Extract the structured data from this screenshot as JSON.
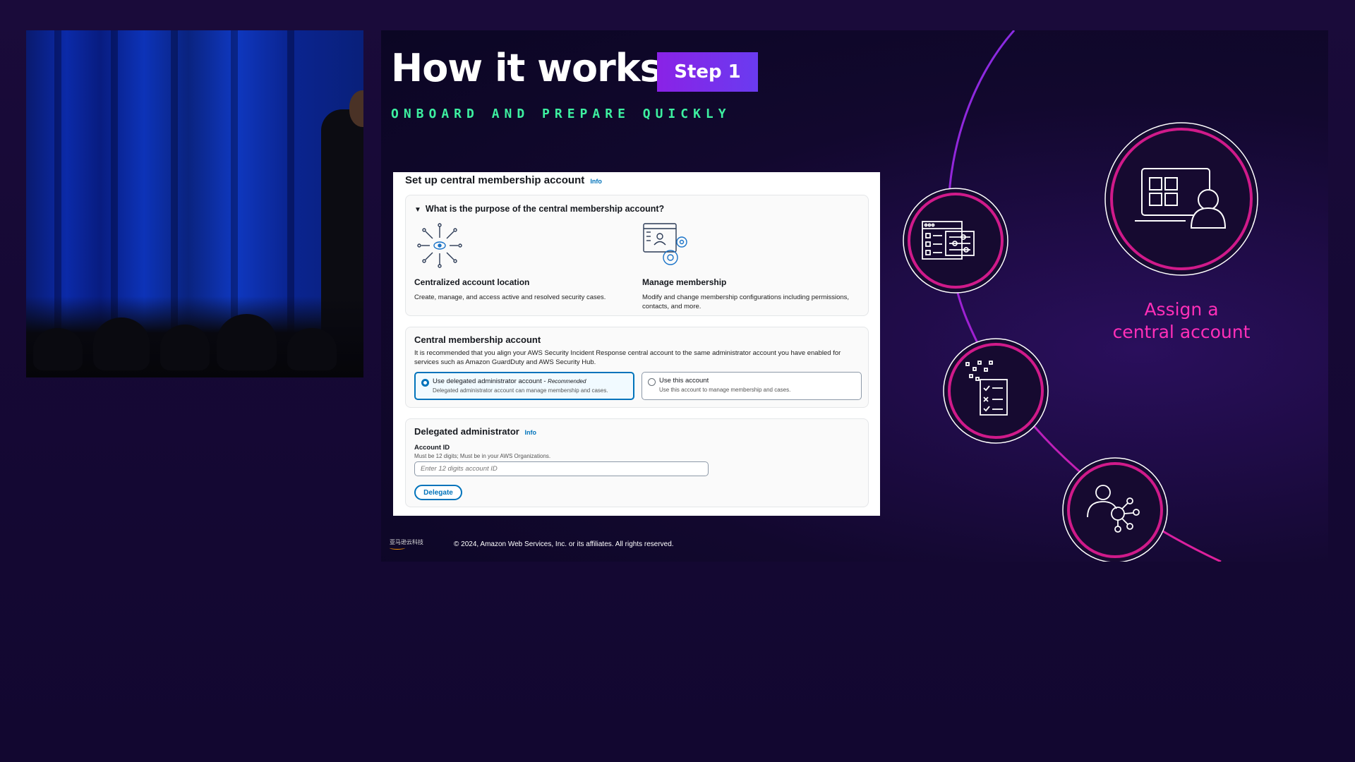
{
  "slide": {
    "title": "How it works",
    "step_badge": "Step 1",
    "subtitle": "ONBOARD AND PREPARE QUICKLY",
    "assign_line1": "Assign a",
    "assign_line2": "central account",
    "copyright": "© 2024, Amazon Web Services, Inc. or its affiliates. All rights reserved.",
    "logo_text": "亚马逊云科技"
  },
  "console": {
    "title": "Set up central membership account",
    "info_label": "Info",
    "question": "What is the purpose of the central membership account?",
    "features": [
      {
        "name": "Centralized account location",
        "desc": "Create, manage, and access active and resolved security cases."
      },
      {
        "name": "Manage membership",
        "desc": "Modify and change membership configurations including permissions, contacts, and more."
      }
    ],
    "central_account": {
      "heading": "Central membership account",
      "desc": "It is recommended that you align your AWS Security Incident Response central account to the same administrator account you have enabled for services such as Amazon GuardDuty and AWS Security Hub.",
      "options": [
        {
          "label": "Use delegated administrator account - ",
          "tag": "Recommended",
          "desc": "Delegated administrator account can manage membership and cases.",
          "selected": true
        },
        {
          "label": "Use this account",
          "tag": "",
          "desc": "Use this account to manage membership and cases.",
          "selected": false
        }
      ]
    },
    "delegated_admin": {
      "heading": "Delegated administrator",
      "field_label": "Account ID",
      "field_hint": "Must be 12 digits; Must be in your AWS Organizations.",
      "placeholder": "Enter 12 digits account ID",
      "button": "Delegate"
    }
  },
  "colors": {
    "accent_pink": "#ff2fb8",
    "subtitle_green": "#3df0a0",
    "badge_purple": "#8a22e6",
    "aws_blue": "#0073bb"
  },
  "icons": [
    "eye-network-icon",
    "settings-window-icon",
    "dashboard-window-icon",
    "laptop-user-icon",
    "checklist-document-icon",
    "user-network-icon"
  ]
}
